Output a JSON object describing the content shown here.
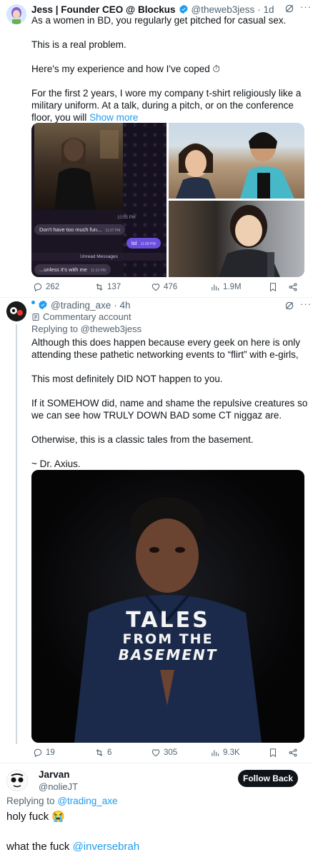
{
  "tweet1": {
    "name": "Jess | Founder CEO @ Blockus",
    "handle": "@theweb3jess",
    "time": "· 1d",
    "lines": [
      "As a women in BD, you regularly get pitched for casual sex.",
      "",
      "This is a real problem.",
      "",
      "Here's my experience and how I've coped ⏱",
      "",
      "For the first 2 years, I wore my company t-shirt religiously like a",
      "military uniform. At a talk, during a pitch, or on the conference"
    ],
    "last_line": "floor, you will",
    "show_more": "Show more",
    "chat": {
      "time1": "10:55 PM",
      "msg1": "Don't have too much fun...",
      "msg1_time": "11:07 PM",
      "msg2": "lol",
      "msg2_time": "11:08 PM",
      "unread": "Unread Messages",
      "msg3": "...unless it's with me",
      "msg3_time": "11:10 PM"
    },
    "stats": {
      "replies": "262",
      "reposts": "137",
      "likes": "476",
      "views": "1.9M"
    }
  },
  "tweet2": {
    "handle": "@trading_axe",
    "time": "· 4h",
    "badge_label": "Commentary account",
    "replying_prefix": "Replying to",
    "replying_to": "@theweb3jess",
    "lines": [
      "Although this does happen because every geek on here is only",
      "attending these pathetic networking events to “flirt” with e-girls,",
      "",
      "This most definitely DID NOT happen to you.",
      "",
      "If it SOMEHOW did, name and shame the repulsive creatures so",
      "we can see how TRULY DOWN BAD some CT niggaz are.",
      "",
      "Otherwise, this is a classic tales from the basement.",
      "",
      "~ Dr. Axius."
    ],
    "poster": {
      "line1": "TALES",
      "line2": "FROM THE",
      "line3": "BASEMENT"
    },
    "stats": {
      "replies": "19",
      "reposts": "6",
      "likes": "305",
      "views": "9.3K"
    }
  },
  "tweet3": {
    "name": "Jarvan",
    "handle": "@nolieJT",
    "follow_label": "Follow Back",
    "replying_prefix": "Replying to",
    "replying_to": "@trading_axe",
    "line1": "holy fuck 😭",
    "line2_prefix": "what the fuck",
    "line2_mention": "@inversebrah"
  },
  "colors": {
    "link": "#1d9bf0",
    "verified": "#1d9bf0",
    "muted": "#536471"
  }
}
